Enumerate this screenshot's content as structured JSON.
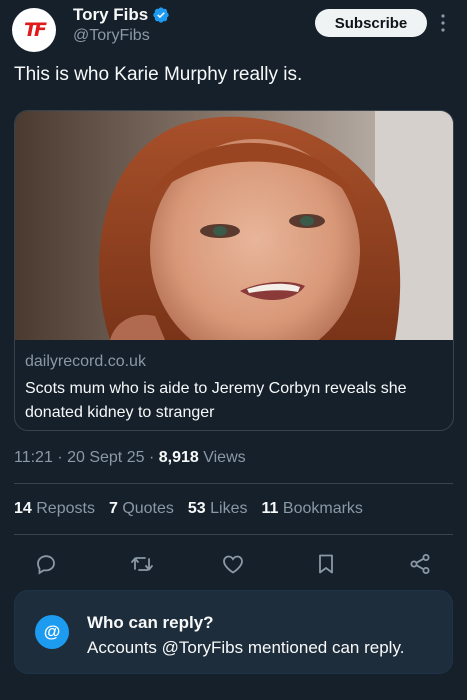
{
  "author": {
    "avatar_text": "TF",
    "display_name": "Tory Fibs",
    "handle": "@ToryFibs"
  },
  "subscribe_label": "Subscribe",
  "tweet_text": "This is who Karie Murphy really is.",
  "card": {
    "domain": "dailyrecord.co.uk",
    "title": "Scots mum who is aide to Jeremy Corbyn reveals she donated kidney to stranger"
  },
  "meta": {
    "time": "11:21",
    "sep1": "·",
    "date": "20 Sept 25",
    "sep2": "·",
    "views_count": "8,918",
    "views_label": "Views"
  },
  "stats": [
    {
      "count": "14",
      "label": "Reposts"
    },
    {
      "count": "7",
      "label": "Quotes"
    },
    {
      "count": "53",
      "label": "Likes"
    },
    {
      "count": "11",
      "label": "Bookmarks"
    }
  ],
  "reply_restriction": {
    "icon": "@",
    "title": "Who can reply?",
    "subtitle": "Accounts @ToryFibs mentioned can reply."
  },
  "colors": {
    "background": "#15202b",
    "accent": "#1d9bf0",
    "secondary_text": "#8b98a5",
    "border": "#38444d",
    "brand_red": "#e0191b"
  }
}
